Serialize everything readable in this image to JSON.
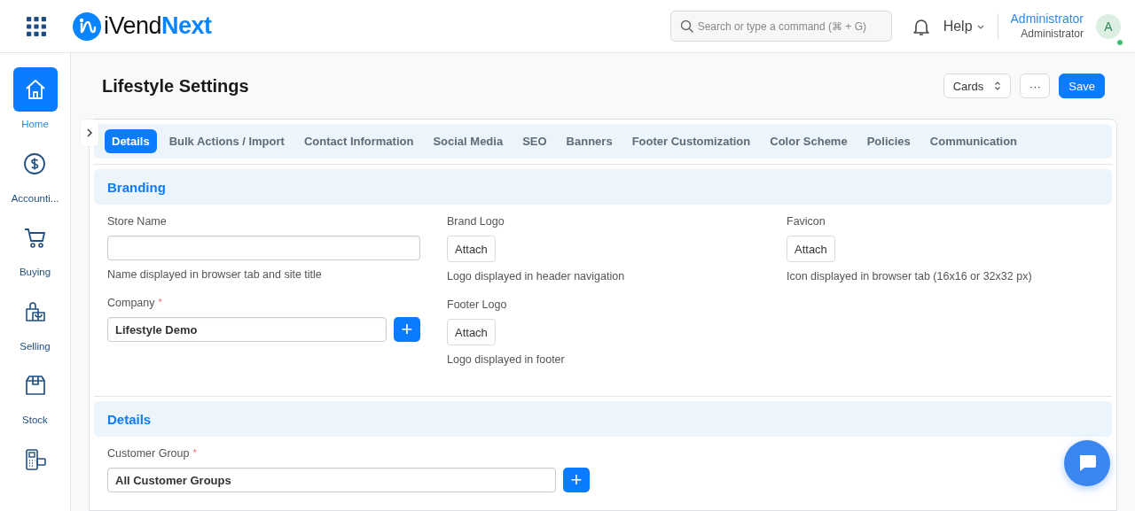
{
  "header": {
    "logo": {
      "parts": [
        "iVend",
        "Next"
      ]
    },
    "search": {
      "placeholder": "Search or type a command (⌘ + G)"
    },
    "help": "Help",
    "user": {
      "name": "Administrator",
      "role": "Administrator",
      "avatar": "A",
      "online": true
    }
  },
  "sidebar": {
    "items": [
      {
        "label": "Home",
        "selected": true
      },
      {
        "label": "Accounti...",
        "selected": false
      },
      {
        "label": "Buying",
        "selected": false
      },
      {
        "label": "Selling",
        "selected": false
      },
      {
        "label": "Stock",
        "selected": false
      },
      {
        "selected": false
      }
    ]
  },
  "page": {
    "title": "Lifestyle Settings",
    "view_button": "Cards",
    "more_button": "···",
    "save_button": "Save"
  },
  "tabs": [
    {
      "label": "Details",
      "selected": true
    },
    {
      "label": "Bulk Actions / Import",
      "selected": false
    },
    {
      "label": "Contact Information",
      "selected": false
    },
    {
      "label": "Social Media",
      "selected": false
    },
    {
      "label": "SEO",
      "selected": false
    },
    {
      "label": "Banners",
      "selected": false
    },
    {
      "label": "Footer Customization",
      "selected": false
    },
    {
      "label": "Color Scheme",
      "selected": false
    },
    {
      "label": "Policies",
      "selected": false
    },
    {
      "label": "Communication",
      "selected": false
    }
  ],
  "sections": [
    {
      "title": "Branding",
      "columns": [
        [
          {
            "kind": "text",
            "label": "Store Name",
            "description": "Name displayed in browser tab and site title"
          },
          {
            "kind": "link",
            "label": "Company",
            "required_mark": "*",
            "value": "Lifestyle Demo",
            "add_button": "+"
          }
        ],
        [
          {
            "kind": "attach",
            "label": "Brand Logo",
            "button": "Attach",
            "description": "Logo displayed in header navigation"
          },
          {
            "kind": "attach",
            "label": "Footer Logo",
            "button": "Attach",
            "description": "Logo displayed in footer"
          }
        ],
        [
          {
            "kind": "attach",
            "label": "Favicon",
            "button": "Attach",
            "description": "Icon displayed in browser tab (16x16 or 32x32 px)"
          }
        ]
      ]
    },
    {
      "title": "Details",
      "columns": [
        [
          {
            "kind": "link",
            "label": "Customer Group",
            "required_mark": "*",
            "value": "All Customer Groups",
            "add_button": "+"
          }
        ],
        []
      ]
    }
  ]
}
